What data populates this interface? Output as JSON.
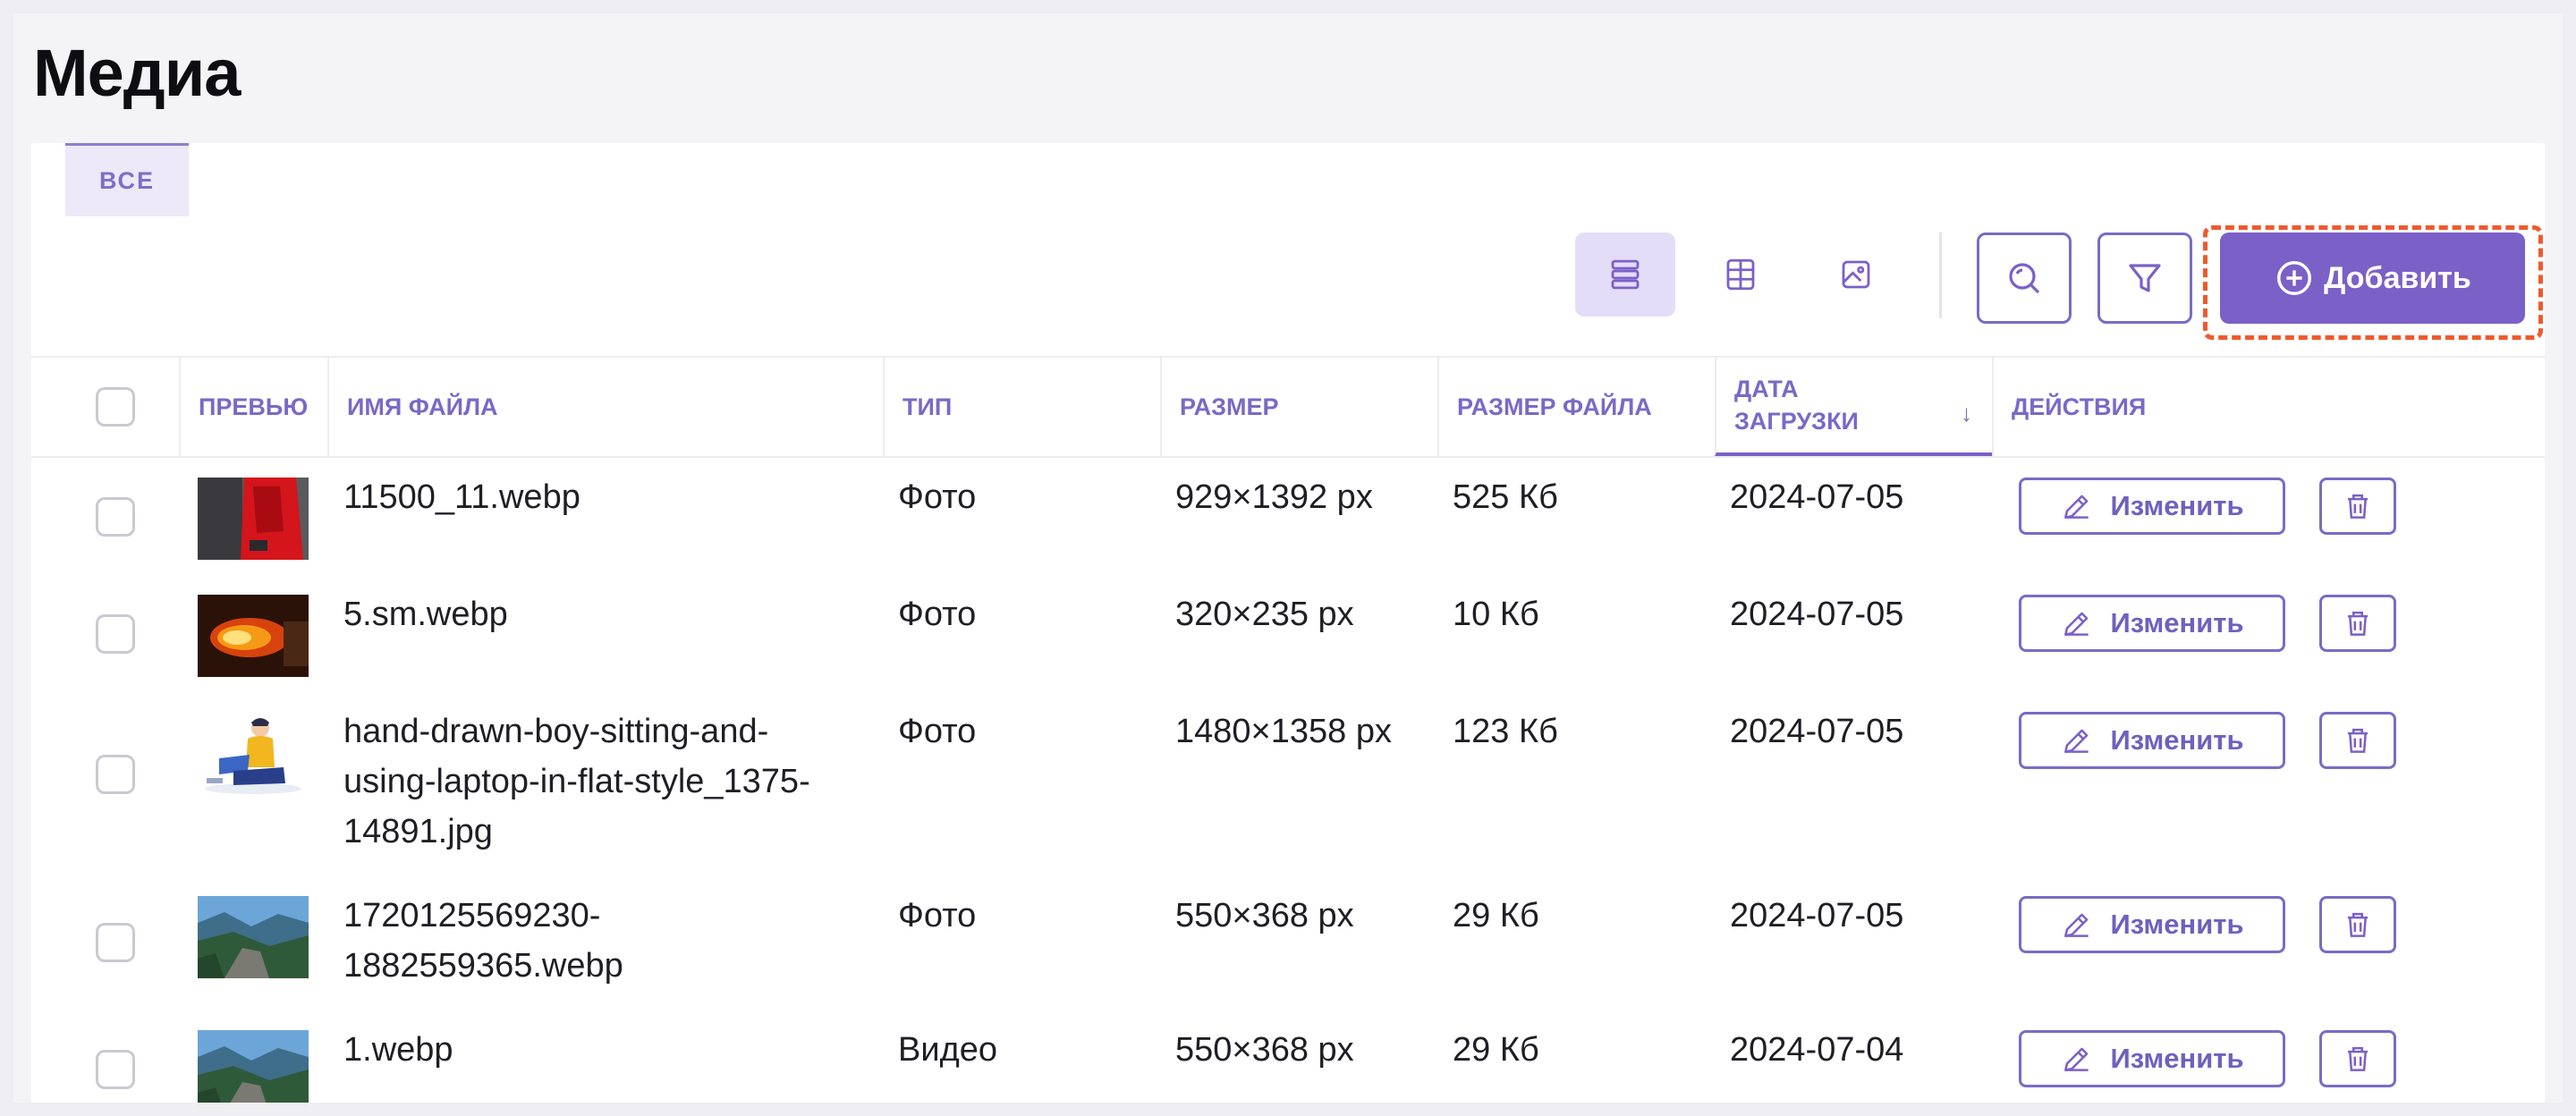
{
  "page": {
    "title": "Медиа"
  },
  "tabs": {
    "all": "ВСЕ"
  },
  "toolbar": {
    "add_label": "Добавить"
  },
  "table": {
    "headers": {
      "preview": "ПРЕВЬЮ",
      "filename": "ИМЯ ФАЙЛА",
      "type": "ТИП",
      "size": "РАЗМЕР",
      "filesize": "РАЗМЕР ФАЙЛА",
      "date_line1": "ДАТА",
      "date_line2": "ЗАГРУЗКИ",
      "actions": "ДЕЙСТВИЯ"
    },
    "sort_indicator": "↓",
    "edit_label": "Изменить",
    "rows": [
      {
        "filename_lines": [
          "11500_11.webp"
        ],
        "type": "Фото",
        "size": "929×1392 px",
        "filesize": "525 Кб",
        "date": "2024-07-05"
      },
      {
        "filename_lines": [
          "5.sm.webp"
        ],
        "type": "Фото",
        "size": "320×235 px",
        "filesize": "10 Кб",
        "date": "2024-07-05"
      },
      {
        "filename_lines": [
          "hand-drawn-boy-sitting-and-",
          "using-laptop-in-flat-style_1375-",
          "14891.jpg"
        ],
        "type": "Фото",
        "size": "1480×1358 px",
        "filesize": "123 Кб",
        "date": "2024-07-05"
      },
      {
        "filename_lines": [
          "1720125569230-",
          "1882559365.webp"
        ],
        "type": "Фото",
        "size": "550×368 px",
        "filesize": "29 Кб",
        "date": "2024-07-05"
      },
      {
        "filename_lines": [
          "1.webp"
        ],
        "type": "Видео",
        "size": "550×368 px",
        "filesize": "29 Кб",
        "date": "2024-07-04"
      }
    ]
  },
  "colors": {
    "accent": "#7b60c8",
    "highlight": "#ee5a2e"
  }
}
